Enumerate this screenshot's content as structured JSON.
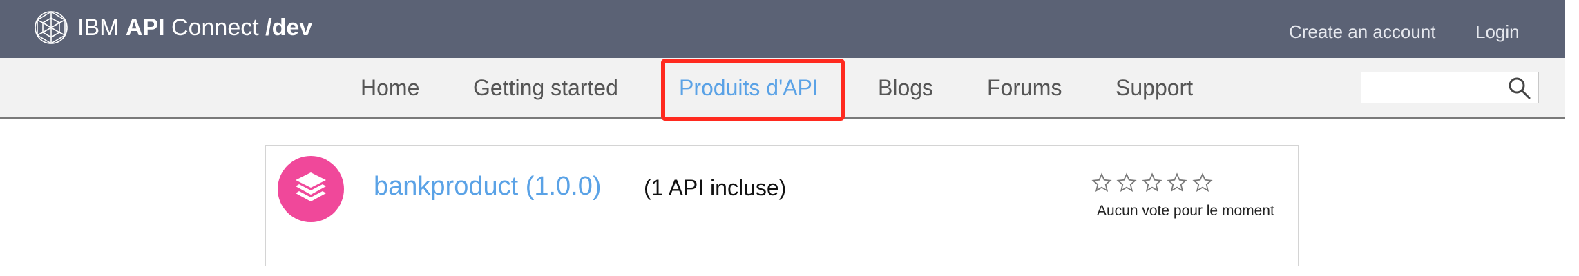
{
  "header": {
    "brand_prefix": "IBM ",
    "brand_bold": "API",
    "brand_middle": " Connect ",
    "brand_env": "/dev",
    "create_account": "Create an account",
    "login": "Login",
    "logo_icon": "ibm-network-globe-icon"
  },
  "nav": {
    "items": [
      {
        "label": "Home",
        "active": false
      },
      {
        "label": "Getting started",
        "active": false
      },
      {
        "label": "Produits d'API",
        "active": true
      },
      {
        "label": "Blogs",
        "active": false
      },
      {
        "label": "Forums",
        "active": false
      },
      {
        "label": "Support",
        "active": false
      }
    ],
    "search": {
      "value": "",
      "placeholder": "",
      "icon": "search-icon"
    }
  },
  "product": {
    "icon": "stacked-layers-icon",
    "name": "bankproduct (1.0.0)",
    "api_count": "(1 API incluse)",
    "rating": {
      "stars_filled": 0,
      "stars_total": 5,
      "text": "Aucun vote pour le moment"
    }
  },
  "colors": {
    "header_bg": "#5b6275",
    "nav_bg": "#f2f2f2",
    "accent": "#5aa2e6",
    "highlight": "#ff2a1f",
    "product_icon": "#f0489a"
  }
}
